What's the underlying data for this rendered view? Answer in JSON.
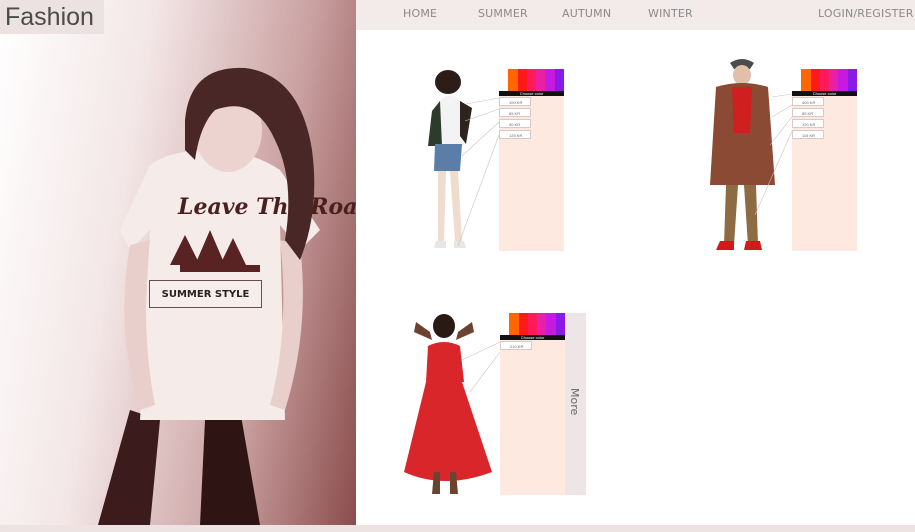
{
  "brand": {
    "logo_text": "Fashion"
  },
  "nav": {
    "items": [
      {
        "label": "HOME"
      },
      {
        "label": "SUMMER"
      },
      {
        "label": "AUTUMN"
      },
      {
        "label": "WINTER"
      }
    ],
    "login_label": "LOGIN/REGISTER"
  },
  "hero": {
    "cta_label": "SUMMER STYLE",
    "shirt_text": "Leave The Road"
  },
  "products": [
    {
      "color_label": "Choose color",
      "sizes": [
        "100 KR",
        "65 KR",
        "90 KR",
        "125 KR"
      ]
    },
    {
      "color_label": "Choose color",
      "sizes": [
        "400 KR",
        "85 KR",
        "120 KR",
        "115 KR"
      ]
    },
    {
      "color_label": "Choose color",
      "sizes": [
        "210 KR"
      ]
    }
  ],
  "colors": {
    "swatches": [
      "#ffffff",
      "#ff6600",
      "#ff1a1a",
      "#ff1a5a",
      "#e91fa6",
      "#c61ae0",
      "#8a1ae6"
    ],
    "panel": "#fde9df"
  },
  "more_label": "More"
}
